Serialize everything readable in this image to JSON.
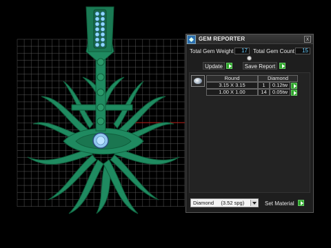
{
  "panel": {
    "title": "GEM REPORTER",
    "close_label": "x",
    "total_gem_weight_label": "Total Gem Weight",
    "total_gem_weight_value": "17",
    "total_gem_count_label": "Total Gem Count",
    "total_gem_count_value": "15",
    "update_label": "Update",
    "save_report_label": "Save Report",
    "table": {
      "headers": [
        "Round",
        "Diamond"
      ],
      "rows": [
        {
          "size": "3.15 X 3.15",
          "count": "1",
          "weight": "0.12tw"
        },
        {
          "size": "1.00 X 1.00",
          "count": "14",
          "weight": "0.05tw"
        }
      ]
    },
    "material_select_value": "Diamond     (3.52 spg)",
    "set_material_label": "Set Material"
  },
  "colors": {
    "accent_green": "#2ea52a",
    "model_green": "#1f8a60",
    "value_text": "#66ccff"
  }
}
